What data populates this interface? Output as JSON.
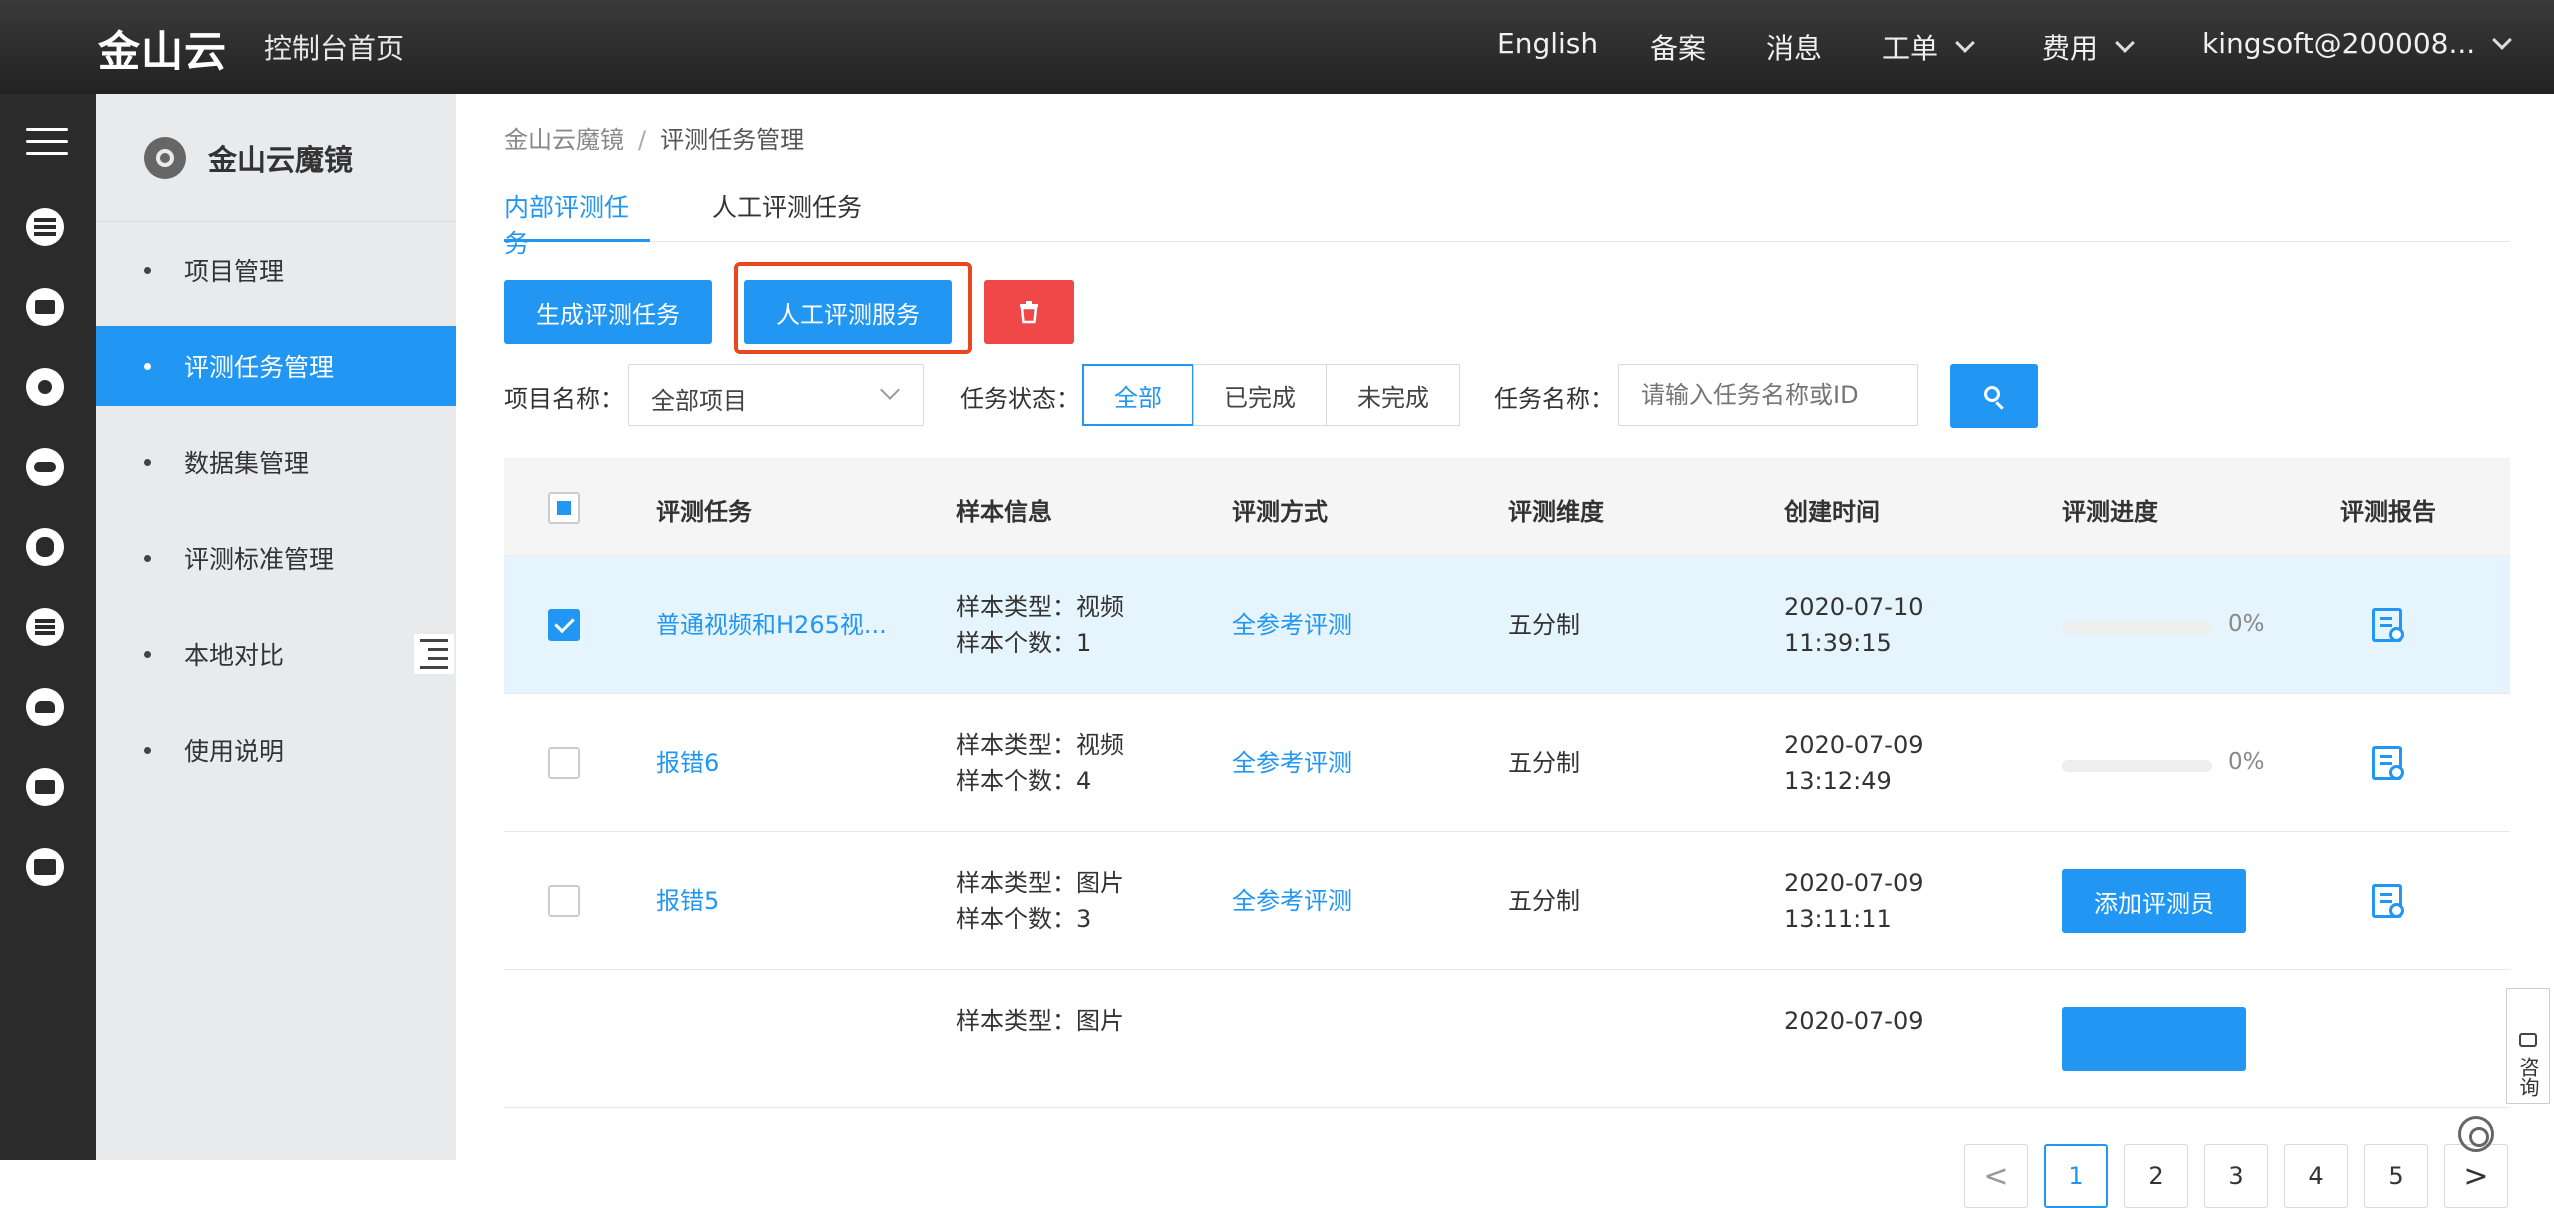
{
  "topbar": {
    "logo": "金山云",
    "console_home": "控制台首页",
    "nav": [
      "English",
      "备案",
      "消息",
      "工单",
      "费用",
      "kingsoft@200008..."
    ]
  },
  "rail": {
    "icons": [
      "menu-icon",
      "server-icon",
      "monitor-icon",
      "network-icon",
      "cloud-icon",
      "database-icon",
      "storage-icon",
      "upload-cloud-icon",
      "mail-icon",
      "contact-card-icon"
    ]
  },
  "sidebar": {
    "title": "金山云魔镜",
    "items": [
      {
        "label": "项目管理"
      },
      {
        "label": "评测任务管理"
      },
      {
        "label": "数据集管理"
      },
      {
        "label": "评测标准管理"
      },
      {
        "label": "本地对比"
      },
      {
        "label": "使用说明"
      }
    ],
    "active_index": 1
  },
  "breadcrumb": {
    "root": "金山云魔镜",
    "separator": "/",
    "current": "评测任务管理"
  },
  "tabs": [
    {
      "label": "内部评测任务"
    },
    {
      "label": "人工评测任务"
    }
  ],
  "toolbar": {
    "create_label": "生成评测任务",
    "human_service_label": "人工评测服务"
  },
  "filters": {
    "project_label": "项目名称：",
    "project_value": "全部项目",
    "status_label": "任务状态：",
    "status_options": [
      "全部",
      "已完成",
      "未完成"
    ],
    "name_label": "任务名称：",
    "name_placeholder": "请输入任务名称或ID"
  },
  "table": {
    "headers": [
      "评测任务",
      "样本信息",
      "评测方式",
      "评测维度",
      "创建时间",
      "评测进度",
      "评测报告"
    ],
    "rows": [
      {
        "name": "普通视频和H265视...",
        "sample_type": "样本类型：视频",
        "sample_count": "样本个数：1",
        "method": "全参考评测",
        "dimension": "五分制",
        "date": "2020-07-10",
        "time": "11:39:15",
        "progress": 0,
        "progress_text": "0%",
        "checked": true
      },
      {
        "name": "报错6",
        "sample_type": "样本类型：视频",
        "sample_count": "样本个数：4",
        "method": "全参考评测",
        "dimension": "五分制",
        "date": "2020-07-09",
        "time": "13:12:49",
        "progress": 0,
        "progress_text": "0%",
        "checked": false
      },
      {
        "name": "报错5",
        "sample_type": "样本类型：图片",
        "sample_count": "样本个数：3",
        "method": "全参考评测",
        "dimension": "五分制",
        "date": "2020-07-09",
        "time": "13:11:11",
        "action": "添加评测员",
        "checked": false
      },
      {
        "name": "",
        "sample_type": "样本类型：图片",
        "sample_count": "",
        "method": "",
        "dimension": "",
        "date": "2020-07-09",
        "time": "",
        "checked": false
      }
    ]
  },
  "pagination": {
    "prev": "<",
    "pages": [
      "1",
      "2",
      "3",
      "4",
      "5"
    ],
    "next": ">",
    "current": "1"
  },
  "consult": {
    "label": "咨询"
  },
  "colors": {
    "primary": "#2196f3",
    "danger": "#f04848",
    "highlight": "#e8471d",
    "topbar": "#2a2a2a"
  }
}
